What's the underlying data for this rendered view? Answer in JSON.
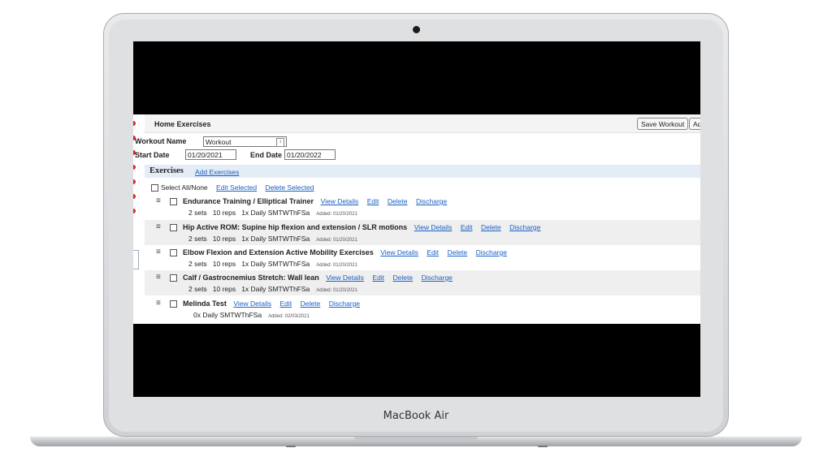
{
  "device": {
    "brand": "MacBook Air"
  },
  "page": {
    "title": "Home Exercises",
    "buttons": {
      "save": "Save Workout",
      "add": "Add Ex"
    }
  },
  "form": {
    "workout_name_label": "Workout Name",
    "workout_name_value": "Workout",
    "start_date_label": "Start Date",
    "start_date_value": "01/20/2021",
    "end_date_label": "End Date",
    "end_date_value": "01/20/2022"
  },
  "exercises_section": {
    "title": "Exercises",
    "add_link": "Add Exercises",
    "select_all": "Select All/None",
    "edit_selected": "Edit Selected",
    "delete_selected": "Delete Selected"
  },
  "actions": {
    "view": "View Details",
    "edit": "Edit",
    "delete": "Delete",
    "discharge": "Discharge"
  },
  "exercises": [
    {
      "name": "Endurance Training / Elliptical Trainer",
      "details": "2 sets   10 reps   1x Daily SMTWThFSa",
      "added": "Added: 01/20/2021"
    },
    {
      "name": "Hip Active ROM: Supine hip flexion and extension / SLR motions",
      "details": "2 sets   10 reps   1x Daily SMTWThFSa",
      "added": "Added: 01/20/2021"
    },
    {
      "name": "Elbow Flexion and Extension Active Mobility Exercises",
      "details": "2 sets   10 reps   1x Daily SMTWThFSa",
      "added": "Added: 01/20/2021"
    },
    {
      "name": "Calf / Gastrocnemius Stretch: Wall lean",
      "details": "2 sets   10 reps   1x Daily SMTWThFSa",
      "added": "Added: 01/20/2021"
    },
    {
      "name": "Melinda Test",
      "details": "0x Daily SMTWThFSa",
      "added": "Added: 02/03/2021"
    }
  ],
  "icons": {
    "drag": "drag-handle-icon",
    "camera": "camera-icon"
  }
}
